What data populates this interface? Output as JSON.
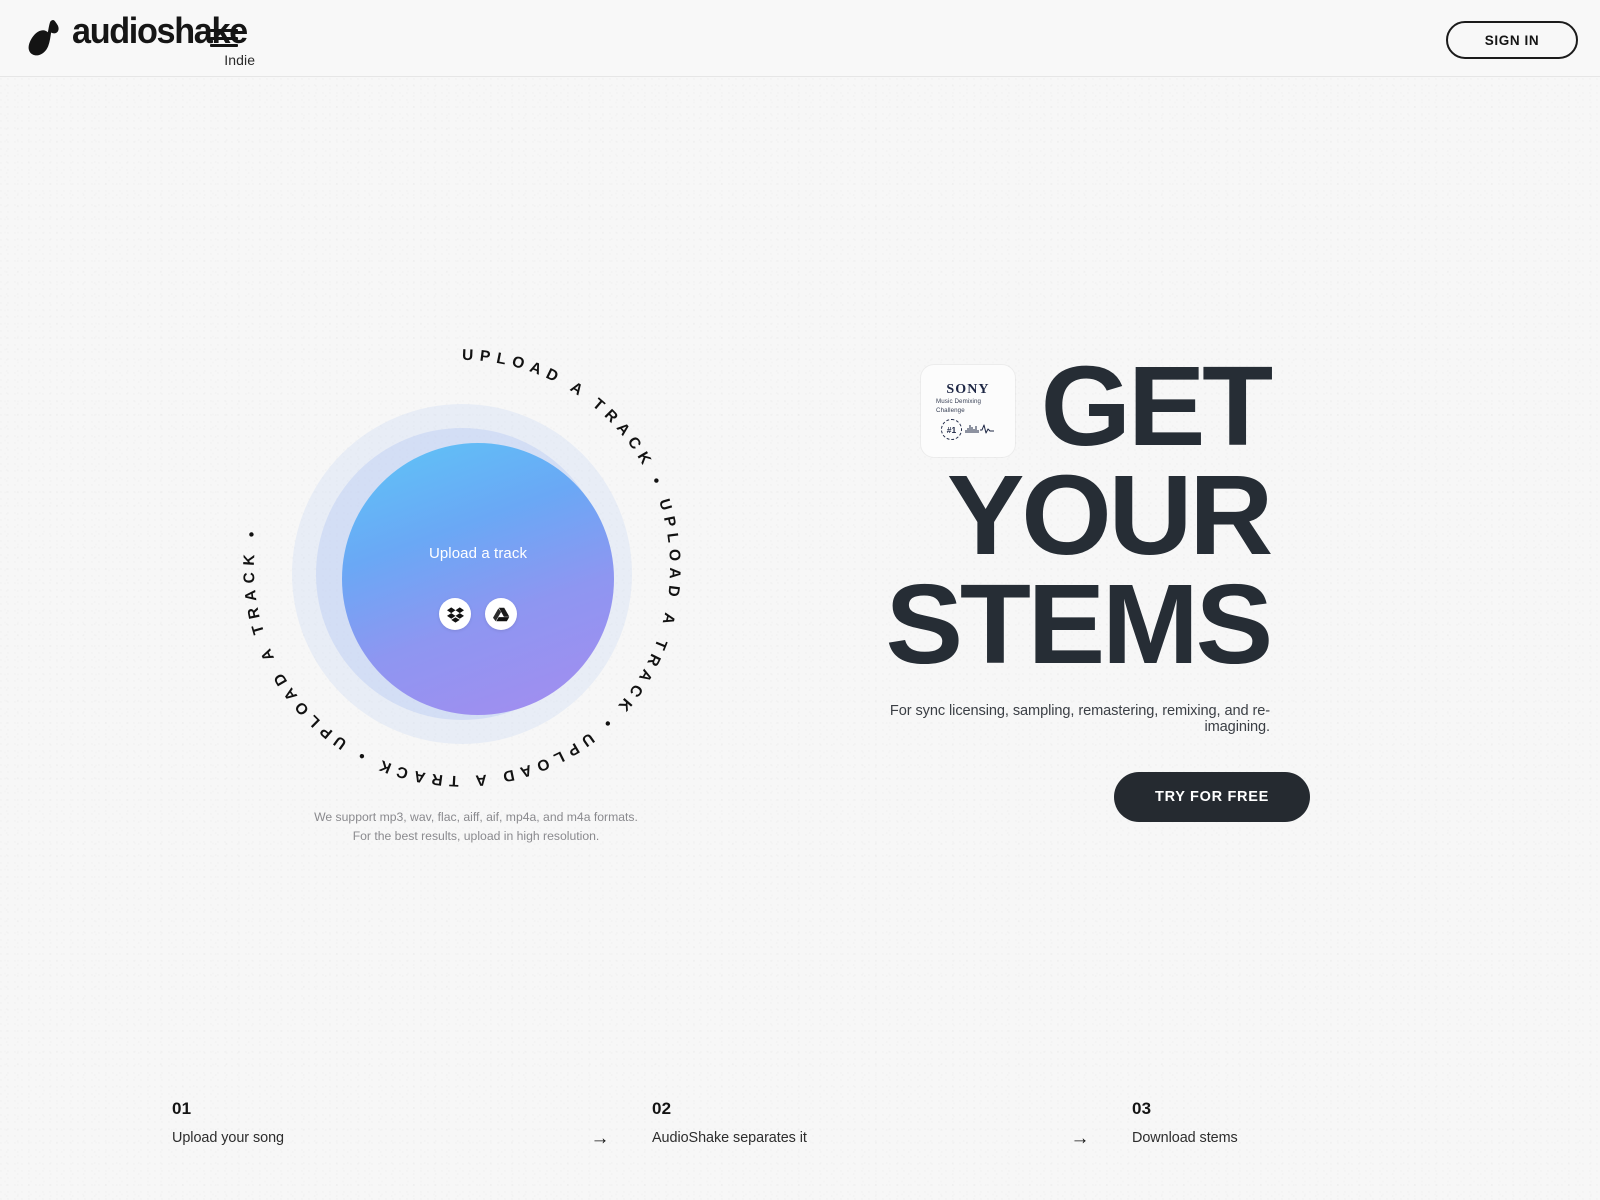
{
  "colors": {
    "page_bg": "#f7f7f7",
    "ink": "#141414",
    "headline": "#262d35",
    "cta_bg": "#252a30",
    "muted": "#8a8a8e",
    "disc_from": "#5ec6f7",
    "disc_to": "#a58cf0"
  },
  "header": {
    "brand_word": "audioshake",
    "brand_sub": "Indie",
    "logo_icon": "audioshake-note-logo",
    "menu_icon": "hamburger-menu-icon",
    "signin_label": "SIGN IN"
  },
  "upload": {
    "ring_text": "UPLOAD A TRACK • UPLOAD A TRACK • UPLOAD A TRACK • UPLOAD A TRACK • ",
    "disc_label": "Upload a track",
    "services": [
      {
        "name": "dropbox-icon",
        "label": "Dropbox"
      },
      {
        "name": "google-drive-icon",
        "label": "Google Drive"
      }
    ],
    "formats_line1": "We support mp3, wav, flac, aiff, aif, mp4a, and m4a formats.",
    "formats_line2": "For the best results, upload in high resolution."
  },
  "hero": {
    "badge": {
      "brand": "SONY",
      "line1": "Music Demixing",
      "line2": "Challenge",
      "rank": "#1",
      "waveform_icon": "audio-waveform-icon"
    },
    "headline_line1": "GET",
    "headline_line2": "YOUR",
    "headline_line3": "STEMS",
    "subtitle": "For sync licensing, sampling, remastering, remixing, and re-imagining.",
    "cta_label": "TRY FOR FREE"
  },
  "steps": {
    "arrow_icon": "arrow-right-icon",
    "arrow_glyph": "→",
    "items": [
      {
        "num": "01",
        "label": "Upload your song"
      },
      {
        "num": "02",
        "label": "AudioShake separates it"
      },
      {
        "num": "03",
        "label": "Download stems"
      }
    ]
  }
}
